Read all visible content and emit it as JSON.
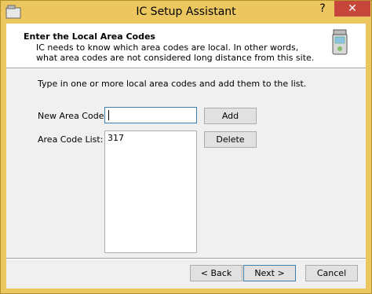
{
  "window": {
    "title": "IC Setup Assistant",
    "help_glyph": "?",
    "close_glyph": "✕"
  },
  "header": {
    "title": "Enter the Local Area Codes",
    "description": "IC needs to know which area codes are local. In other words, what area codes are not considered long distance from this site."
  },
  "body": {
    "instruction": "Type in one or more local area codes and add them to the list.",
    "new_area_code_label": "New Area Code:",
    "new_area_code_value": "",
    "area_code_list_label": "Area Code List:",
    "area_codes": [
      "317"
    ],
    "add_label": "Add",
    "delete_label": "Delete"
  },
  "footer": {
    "back_label": "< Back",
    "next_label": "Next >",
    "cancel_label": "Cancel"
  },
  "colors": {
    "title_bar": "#ecc75f",
    "close_button": "#c7463b",
    "focus_border": "#3c7fb1"
  }
}
